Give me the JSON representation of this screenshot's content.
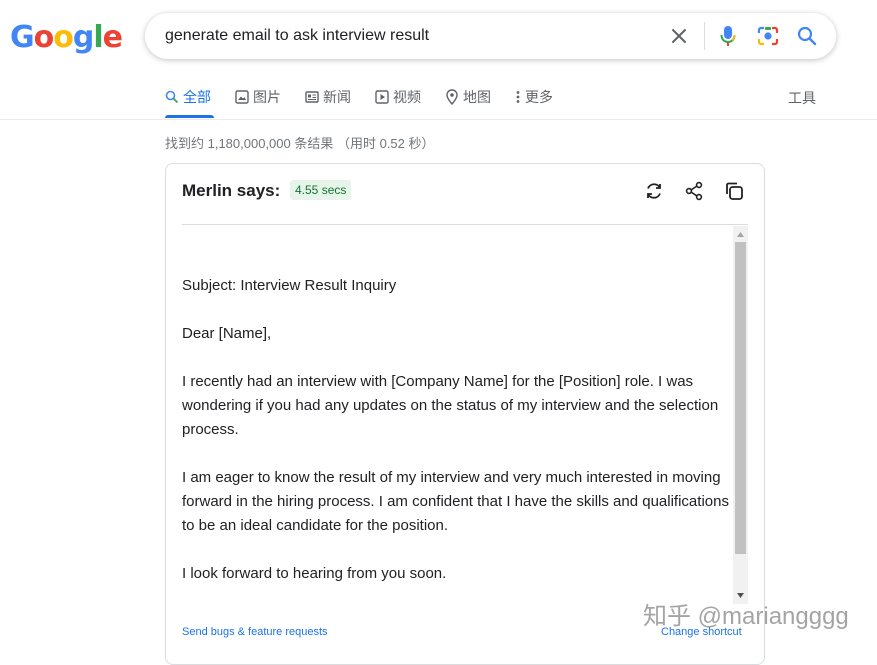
{
  "logo": {
    "letters": [
      "G",
      "o",
      "o",
      "g",
      "l",
      "e"
    ],
    "colors": [
      "#4285F4",
      "#EA4335",
      "#FBBC05",
      "#4285F4",
      "#34A853",
      "#EA4335"
    ]
  },
  "search": {
    "value": "generate email to ask interview result",
    "icons": [
      "clear-icon",
      "microphone-icon",
      "camera-lens-icon",
      "search-icon"
    ]
  },
  "tabs": [
    {
      "label": "全部",
      "icon": "search-icon",
      "active": true
    },
    {
      "label": "图片",
      "icon": "image-icon"
    },
    {
      "label": "新闻",
      "icon": "news-icon"
    },
    {
      "label": "视频",
      "icon": "play-icon"
    },
    {
      "label": "地图",
      "icon": "map-pin-icon"
    },
    {
      "label": "更多",
      "icon": "more-vert-icon"
    }
  ],
  "tools_label": "工具",
  "stats": "找到约 1,180,000,000 条结果 （用时 0.52 秒）",
  "merlin": {
    "title": "Merlin says:",
    "time": "4.55 secs",
    "icons": [
      "refresh-icon",
      "share-icon",
      "copy-icon"
    ],
    "subject": "Subject: Interview Result Inquiry",
    "greeting": "Dear [Name],",
    "para1": "I recently had an interview with [Company Name] for the [Position] role. I was wondering if you had any updates on the status of my interview and the selection process.",
    "para2": "I am eager to know the result of my interview and very much interested in moving forward in the hiring process. I am confident that I have the skills and qualifications to be an ideal candidate for the position.",
    "closing": "I look forward to hearing from you soon.",
    "bug_link": "Send bugs & feature requests",
    "shortcut_link": "Change shortcut"
  },
  "watermark": "知乎 @mariangggg",
  "colors": {
    "accent": "#1a73e8",
    "badge_bg": "#e6f4ea",
    "badge_text": "#137333"
  }
}
